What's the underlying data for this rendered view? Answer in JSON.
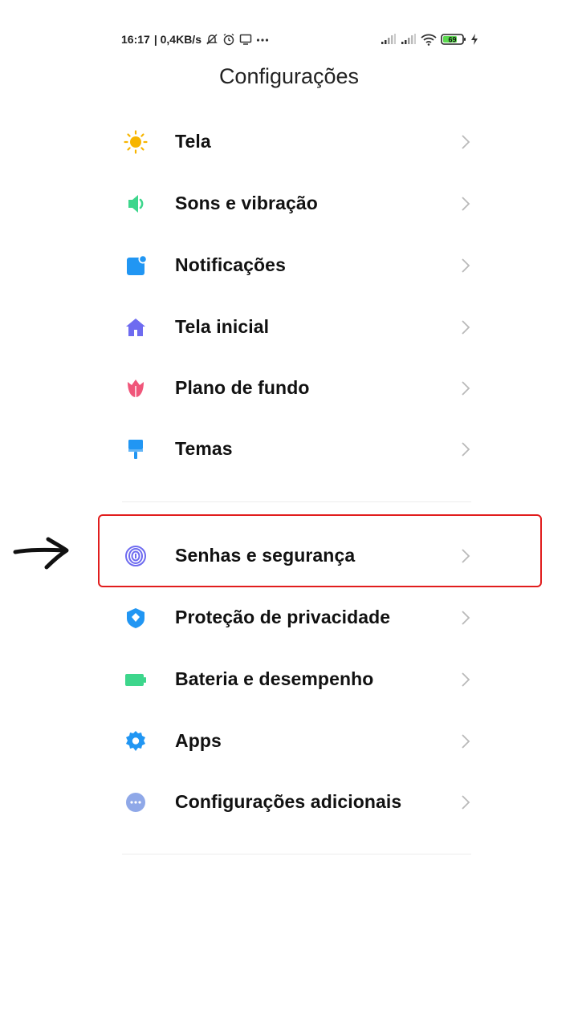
{
  "status_bar": {
    "time": "16:17",
    "network_speed": "| 0,4KB/s",
    "battery_level": "69",
    "icons": [
      "bell-muted-icon",
      "alarm-icon",
      "screen-icon",
      "more-dots-icon",
      "signal-icon",
      "signal-icon",
      "wifi-icon",
      "battery-icon",
      "charging-icon"
    ]
  },
  "header": {
    "title": "Configurações"
  },
  "settings": {
    "group1": [
      {
        "label": "Tela",
        "icon": "brightness-icon",
        "color": "#F7B500"
      },
      {
        "label": "Sons e vibração",
        "icon": "speaker-icon",
        "color": "#3DD68C"
      },
      {
        "label": "Notificações",
        "icon": "notification-icon",
        "color": "#2196F3"
      },
      {
        "label": "Tela inicial",
        "icon": "home-icon",
        "color": "#6E6BF0"
      },
      {
        "label": "Plano de fundo",
        "icon": "tulip-icon",
        "color": "#F0567A"
      },
      {
        "label": "Temas",
        "icon": "paintbrush-icon",
        "color": "#2196F3"
      }
    ],
    "group2": [
      {
        "label": "Senhas e segurança",
        "icon": "fingerprint-icon",
        "color": "#6E6BF0"
      },
      {
        "label": "Proteção de privacidade",
        "icon": "shield-icon",
        "color": "#2196F3"
      },
      {
        "label": "Bateria e desempenho",
        "icon": "battery-icon",
        "color": "#3DD68C"
      },
      {
        "label": "Apps",
        "icon": "gear-icon",
        "color": "#2196F3"
      },
      {
        "label": "Configurações adicionais",
        "icon": "more-dots-icon",
        "color": "#8FA8E8"
      }
    ]
  },
  "annotation": {
    "highlight_color": "#E11D1D",
    "pointer": "arrow-right-icon"
  }
}
